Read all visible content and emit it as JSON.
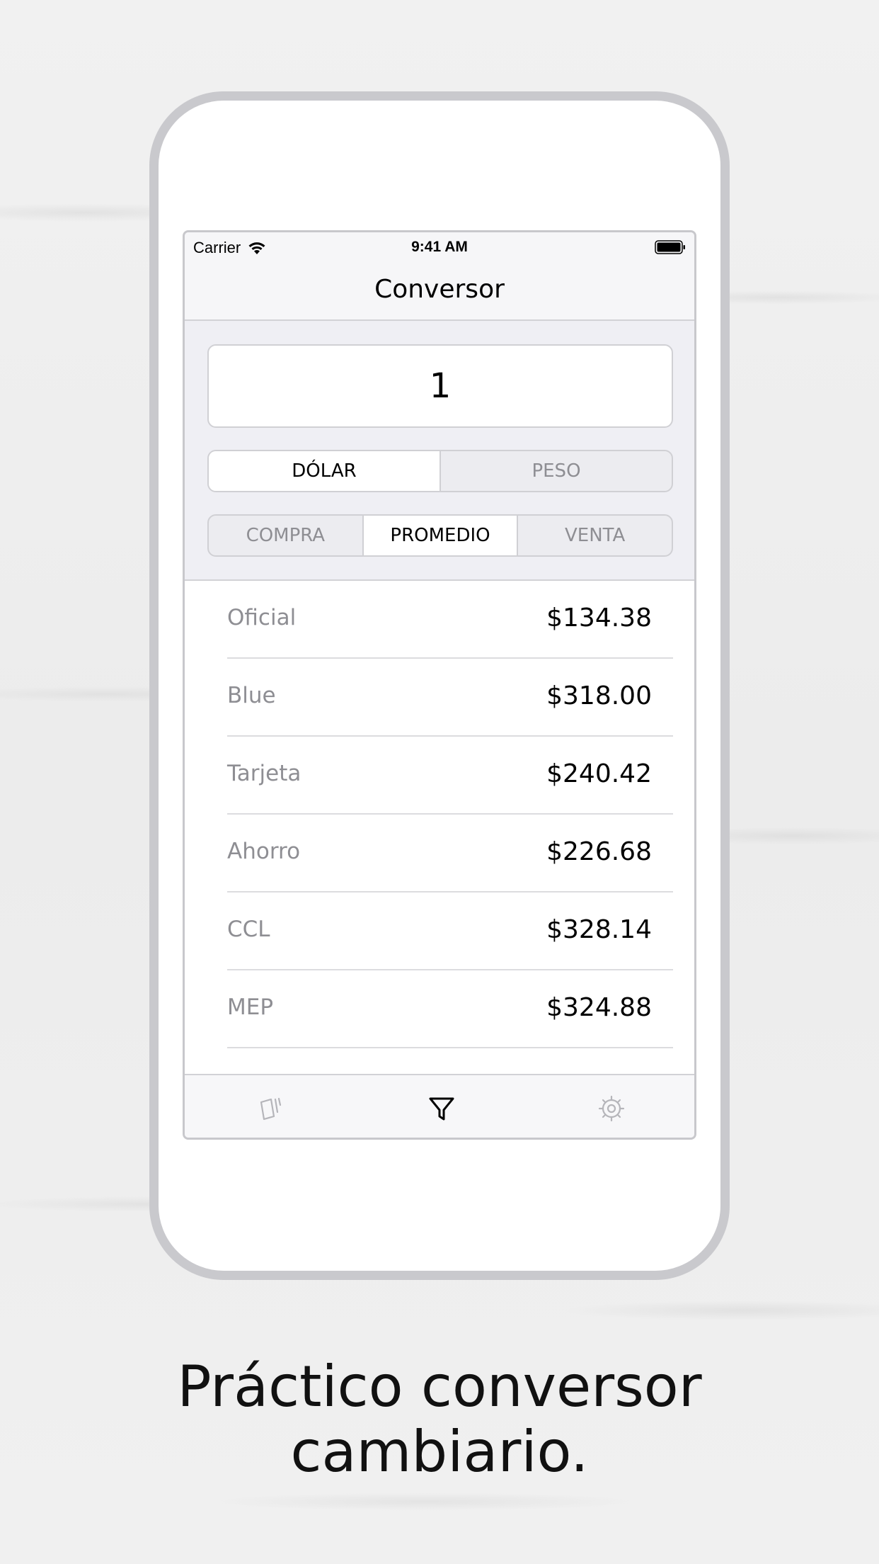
{
  "status_bar": {
    "carrier": "Carrier",
    "time": "9:41 AM"
  },
  "nav": {
    "title": "Conversor"
  },
  "amount": {
    "value": "1"
  },
  "currency_toggle": {
    "options": [
      {
        "label": "DÓLAR",
        "selected": true
      },
      {
        "label": "PESO",
        "selected": false
      }
    ]
  },
  "rate_toggle": {
    "options": [
      {
        "label": "COMPRA",
        "selected": false
      },
      {
        "label": "PROMEDIO",
        "selected": true
      },
      {
        "label": "VENTA",
        "selected": false
      }
    ]
  },
  "rates": [
    {
      "label": "Oficial",
      "value": "$134.38"
    },
    {
      "label": "Blue",
      "value": "$318.00"
    },
    {
      "label": "Tarjeta",
      "value": "$240.42"
    },
    {
      "label": "Ahorro",
      "value": "$226.68"
    },
    {
      "label": "CCL",
      "value": "$328.14"
    },
    {
      "label": "MEP",
      "value": "$324.88"
    }
  ],
  "tab_bar": {
    "tabs": [
      {
        "icon": "cards-icon",
        "active": false
      },
      {
        "icon": "filter-icon",
        "active": true
      },
      {
        "icon": "gear-icon",
        "active": false
      }
    ]
  },
  "caption": {
    "line1": "Práctico conversor",
    "line2": "cambiario."
  },
  "colors": {
    "active_text": "#000000",
    "inactive_text": "#8e8e93",
    "frame": "#c9c9cd"
  }
}
